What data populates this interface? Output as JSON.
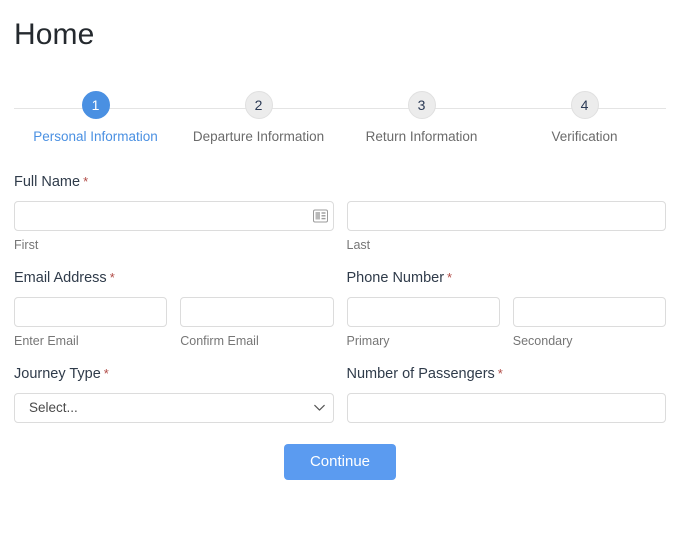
{
  "page": {
    "title": "Home"
  },
  "stepper": {
    "steps": [
      {
        "number": "1",
        "label": "Personal Information",
        "active": true
      },
      {
        "number": "2",
        "label": "Departure Information",
        "active": false
      },
      {
        "number": "3",
        "label": "Return Information",
        "active": false
      },
      {
        "number": "4",
        "label": "Verification",
        "active": false
      }
    ],
    "active_color": "#4a90e2",
    "inactive_circle_color": "#ececec",
    "inactive_label_color": "#6b6b6b",
    "line_color": "#e4e4e4"
  },
  "form": {
    "required_marker": "*",
    "groups": {
      "full_name": {
        "label": "Full Name",
        "first": {
          "value": "",
          "placeholder": "",
          "sub_label": "First",
          "icon": "contact-card-icon"
        },
        "last": {
          "value": "",
          "placeholder": "",
          "sub_label": "Last"
        }
      },
      "email_address": {
        "label": "Email Address",
        "enter": {
          "value": "",
          "placeholder": "",
          "sub_label": "Enter Email"
        },
        "confirm": {
          "value": "",
          "placeholder": "",
          "sub_label": "Confirm Email"
        }
      },
      "phone_number": {
        "label": "Phone Number",
        "primary": {
          "value": "",
          "placeholder": "",
          "sub_label": "Primary"
        },
        "secondary": {
          "value": "",
          "placeholder": "",
          "sub_label": "Secondary"
        }
      },
      "journey_type": {
        "label": "Journey Type",
        "selected": "Select...",
        "options": [
          "Select..."
        ],
        "icon": "chevron-down-icon"
      },
      "passengers": {
        "label": "Number of Passengers",
        "value": "",
        "placeholder": ""
      }
    }
  },
  "actions": {
    "continue_label": "Continue",
    "continue_color": "#5b9bf0"
  }
}
